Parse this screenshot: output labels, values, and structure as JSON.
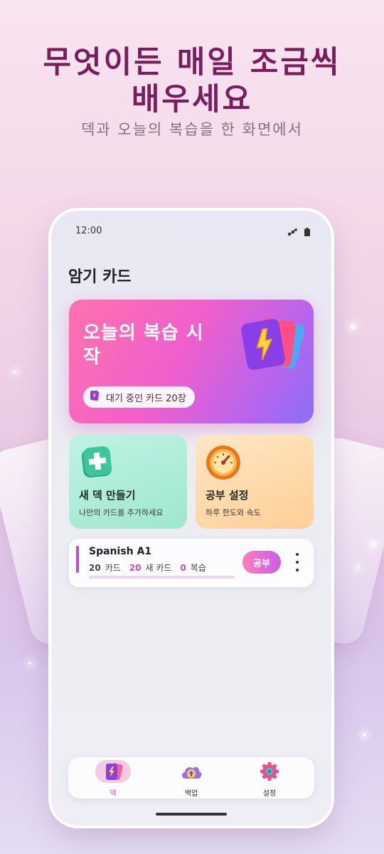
{
  "promo": {
    "headline_line1": "무엇이든 매일 조금씩",
    "headline_line2": "배우세요",
    "subheadline": "덱과 오늘의 복습을 한 화면에서"
  },
  "status_bar": {
    "time": "12:00",
    "icons": [
      "signal-icon",
      "battery-icon"
    ]
  },
  "app": {
    "title": "암기 카드"
  },
  "hero": {
    "title": "오늘의 복습 시작",
    "pending_label": "대기 중인 카드 20장",
    "icon": "flashcards-lightning-icon"
  },
  "tiles": [
    {
      "title": "새 덱 만들기",
      "subtitle": "나만의 카드를 추가하세요",
      "icon": "plus-icon"
    },
    {
      "title": "공부 설정",
      "subtitle": "하루 한도와 속도",
      "icon": "gauge-icon"
    }
  ],
  "deck": {
    "name": "Spanish A1",
    "total": "20",
    "total_label": "카드",
    "new_count": "20",
    "new_label": "새 카드",
    "review_count": "0",
    "review_label": "복습",
    "progress": 0,
    "study_label": "공부"
  },
  "nav": {
    "items": [
      {
        "label": "덱",
        "icon": "deck-icon",
        "active": true
      },
      {
        "label": "백업",
        "icon": "cloud-upload-icon",
        "active": false
      },
      {
        "label": "설정",
        "icon": "gear-icon",
        "active": false
      }
    ]
  },
  "colors": {
    "headline": "#7a1d5c",
    "accent": "#c24ad4",
    "hero_start": "#ff72ad",
    "hero_end": "#8970f6"
  }
}
